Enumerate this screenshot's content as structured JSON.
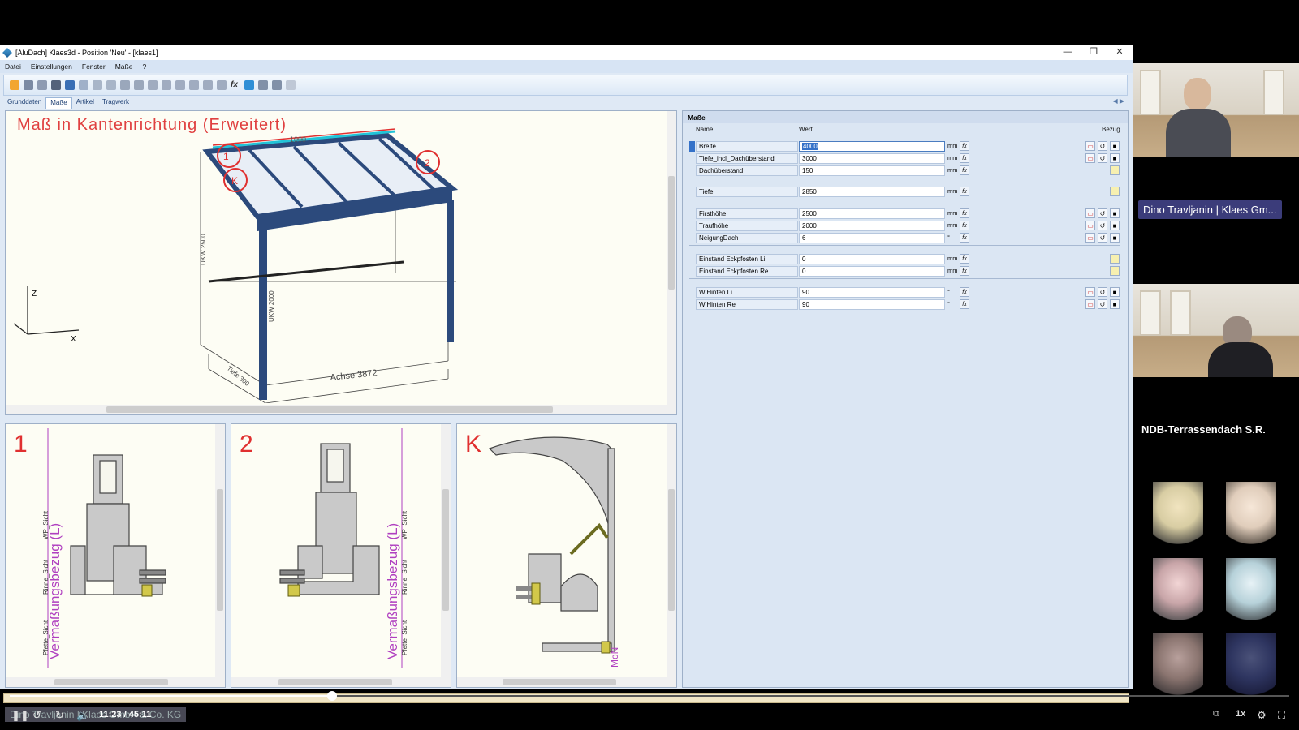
{
  "window": {
    "title": "[AluDach] Klaes3d - Position 'Neu' - [klaes1]",
    "controls": [
      "—",
      "❐",
      "✕"
    ]
  },
  "menu": [
    "Datei",
    "Einstellungen",
    "Fenster",
    "Maße",
    "?"
  ],
  "tabs": [
    {
      "label": "Grunddaten",
      "active": false
    },
    {
      "label": "Maße",
      "active": true
    },
    {
      "label": "Artikel",
      "active": false
    },
    {
      "label": "Tragwerk",
      "active": false
    }
  ],
  "view3d": {
    "title": "Maß in Kantenrichtung (Erweitert)",
    "labels": {
      "dim_top": "1000",
      "dim_axis": "Achse 3872",
      "dim_depth": "Tiefe 300",
      "ok_left": "UKW 2500",
      "ok_post": "UKW 2000",
      "axis_z": "Z",
      "axis_x": "X",
      "marker1": "1",
      "marker2": "2",
      "markerK": "K"
    }
  },
  "profiles": [
    {
      "label": "1",
      "texts": [
        "Vermaßungsbezug (L)",
        "WP_Sicht",
        "Rinne_Sicht",
        "Pfette_Sicht"
      ]
    },
    {
      "label": "2",
      "texts": [
        "Vermaßungsbezug (L)",
        "WP_Sicht",
        "Rinne_Sicht",
        "Pfette_Sicht"
      ]
    },
    {
      "label": "K",
      "texts": [
        "MoN"
      ]
    }
  ],
  "masse": {
    "title": "Maße",
    "headers": {
      "name": "Name",
      "value": "Wert",
      "ref": "Bezug"
    },
    "rows": [
      {
        "name": "Breite",
        "value": "4000",
        "unit": "mm",
        "selected": true,
        "group": 0
      },
      {
        "name": "Tiefe_incl_Dachüberstand",
        "value": "3000",
        "unit": "mm",
        "group": 0
      },
      {
        "name": "Dachüberstand",
        "value": "150",
        "unit": "mm",
        "group": 0
      },
      {
        "name": "Tiefe",
        "value": "2850",
        "unit": "mm",
        "group": 1
      },
      {
        "name": "Firsthöhe",
        "value": "2500",
        "unit": "mm",
        "group": 2
      },
      {
        "name": "Traufhöhe",
        "value": "2000",
        "unit": "mm",
        "group": 2
      },
      {
        "name": "NeigungDach",
        "value": "6",
        "unit": "°",
        "group": 2
      },
      {
        "name": "Einstand Eckpfosten Li",
        "value": "0",
        "unit": "mm",
        "group": 3
      },
      {
        "name": "Einstand Eckpfosten Re",
        "value": "0",
        "unit": "mm",
        "group": 3
      },
      {
        "name": "WiHinten Li",
        "value": "90",
        "unit": "°",
        "group": 4
      },
      {
        "name": "WiHinten Re",
        "value": "90",
        "unit": "°",
        "group": 4
      }
    ],
    "fx_label": "fx"
  },
  "player": {
    "time": "11:23 / 45:11",
    "progress": 0.252,
    "speed": "1x",
    "caption": "Dino Travljanin | Klaes GmbH & Co. KG",
    "icons": [
      "pause-icon",
      "rewind-10-icon",
      "forward-10-icon",
      "volume-icon",
      "captions-icon",
      "settings-icon",
      "fullscreen-icon"
    ]
  },
  "participants": {
    "speaker_name": "Dino Travljanin | Klaes Gm...",
    "group_name": "NDB-Terrassendach S.R."
  },
  "colors": {
    "accent_red": "#e03030",
    "roof_blue": "#2c4a7c",
    "selection": "#3572c9",
    "badge": "#3b3c7a"
  }
}
